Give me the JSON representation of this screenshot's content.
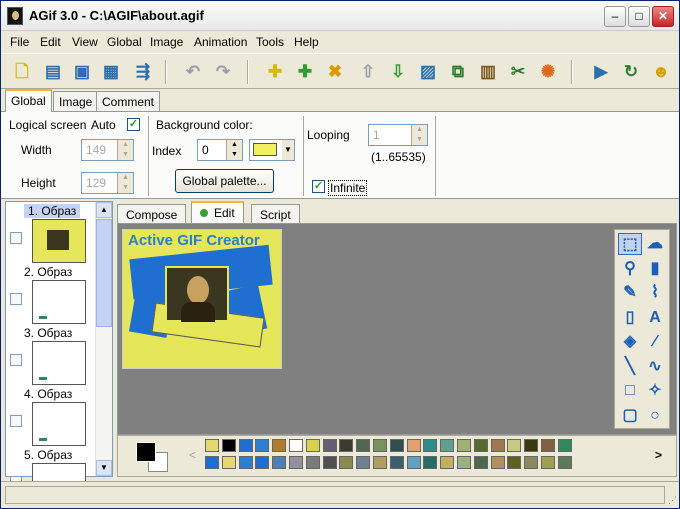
{
  "window": {
    "title": "AGif 3.0 - C:\\AGIF\\about.agif",
    "minimize_glyph": "–",
    "maximize_glyph": "□",
    "close_glyph": "✕"
  },
  "menu": [
    "File",
    "Edit",
    "View",
    "Global",
    "Image",
    "Animation",
    "Tools",
    "Help"
  ],
  "toolbar": {
    "buttons": [
      {
        "name": "new-icon",
        "glyph": "🗋",
        "color": "#d6b800"
      },
      {
        "name": "open-icon",
        "glyph": "▤",
        "color": "#2a6fb0"
      },
      {
        "name": "save-icon",
        "glyph": "▣",
        "color": "#2a6fb0"
      },
      {
        "name": "save-as-icon",
        "glyph": "▦",
        "color": "#2a6fb0"
      },
      {
        "name": "export-icon",
        "glyph": "⇶",
        "color": "#2a6fb0"
      },
      {
        "name": "undo-icon",
        "glyph": "↶",
        "color": "#9aa0a8"
      },
      {
        "name": "redo-icon",
        "glyph": "↷",
        "color": "#9aa0a8"
      },
      {
        "name": "new-frame-icon",
        "glyph": "✚",
        "color": "#d6b800"
      },
      {
        "name": "add-frame-icon",
        "glyph": "✚",
        "color": "#2e9e2e"
      },
      {
        "name": "delete-frame-icon",
        "glyph": "✖",
        "color": "#d89a00"
      },
      {
        "name": "move-up-icon",
        "glyph": "⇧",
        "color": "#9aa0a8"
      },
      {
        "name": "move-down-icon",
        "glyph": "⇩",
        "color": "#3a9e3a"
      },
      {
        "name": "image-props-icon",
        "glyph": "▨",
        "color": "#2a6fb0"
      },
      {
        "name": "duplicate-icon",
        "glyph": "⧉",
        "color": "#2e7d32"
      },
      {
        "name": "frames-icon",
        "glyph": "▥",
        "color": "#7a5a20"
      },
      {
        "name": "optimize-icon",
        "glyph": "✂",
        "color": "#2e7d32"
      },
      {
        "name": "effects-icon",
        "glyph": "✺",
        "color": "#e0661a"
      },
      {
        "name": "preview-icon",
        "glyph": "▶",
        "color": "#2a6fb0"
      },
      {
        "name": "play-icon",
        "glyph": "↻",
        "color": "#2e7d32"
      },
      {
        "name": "about-icon",
        "glyph": "☻",
        "color": "#d6a000"
      }
    ]
  },
  "top_tabs": [
    "Global",
    "Image",
    "Comment"
  ],
  "global": {
    "logical_screen_label": "Logical screen",
    "auto_label": "Auto",
    "auto_checked": "✓",
    "width_label": "Width",
    "width_value": "149",
    "height_label": "Height",
    "height_value": "129",
    "bg_color_label": "Background color:",
    "index_label": "Index",
    "index_value": "0",
    "bg_swatch": "#f0f060",
    "global_palette_button": "Global palette...",
    "looping_label": "Looping",
    "looping_value": "1",
    "looping_range": "(1..65535)",
    "infinite_label": "Infinite",
    "infinite_checked": "✓"
  },
  "frames": [
    {
      "label": "1. Образ",
      "selected": true
    },
    {
      "label": "2. Образ",
      "selected": false
    },
    {
      "label": "3. Образ",
      "selected": false
    },
    {
      "label": "4. Образ",
      "selected": false
    },
    {
      "label": "5. Образ",
      "selected": false
    }
  ],
  "scroll_up": "▲",
  "scroll_down": "▼",
  "sub_tabs": [
    "Compose",
    "Edit",
    "Script"
  ],
  "image": {
    "title": "Active GIF Creator"
  },
  "tools": [
    {
      "name": "select-rect-icon",
      "glyph": "⬚"
    },
    {
      "name": "lasso-icon",
      "glyph": "☁"
    },
    {
      "name": "paint-bucket-icon",
      "glyph": "⚲"
    },
    {
      "name": "eraser-icon",
      "glyph": "▮"
    },
    {
      "name": "pencil-icon",
      "glyph": "✎"
    },
    {
      "name": "brush-icon",
      "glyph": "⌇"
    },
    {
      "name": "marker-icon",
      "glyph": "▯"
    },
    {
      "name": "text-icon",
      "glyph": "A"
    },
    {
      "name": "fill-icon",
      "glyph": "◈"
    },
    {
      "name": "spray-icon",
      "glyph": "⁄"
    },
    {
      "name": "line-icon",
      "glyph": "╲"
    },
    {
      "name": "curve-icon",
      "glyph": "∿"
    },
    {
      "name": "rectangle-icon",
      "glyph": "□"
    },
    {
      "name": "star-icon",
      "glyph": "✧"
    },
    {
      "name": "rounded-rect-icon",
      "glyph": "▢"
    },
    {
      "name": "ellipse-icon",
      "glyph": "○"
    }
  ],
  "palette": {
    "prev_glyph": "<",
    "next_glyph": ">",
    "foreground": "#000000",
    "background": "#ffffff",
    "row1": [
      "#e6d870",
      "#000000",
      "#1e6fd0",
      "#2a7fd0",
      "#b07a30",
      "#ffffff",
      "#d8d050",
      "#606070",
      "#3a3a30",
      "#506850",
      "#7a9060",
      "#2f4f4f",
      "#e0a070",
      "#2e8b8b",
      "#5fa08f",
      "#a0b070",
      "#556b2f",
      "#a07850",
      "#c8c880",
      "#3a3a10",
      "#806040",
      "#2e8b57"
    ],
    "row2": [
      "#1e6fd0",
      "#e6d870",
      "#2a7fd0",
      "#1e6fd0",
      "#5080b0",
      "#9090a0",
      "#7a7a7a",
      "#505050",
      "#8a8a50",
      "#708090",
      "#b0a060",
      "#3a6070",
      "#60a0c0",
      "#2a6a6a",
      "#c0b060",
      "#9ab080",
      "#4a6a4a",
      "#b09060",
      "#606020",
      "#8a8a60",
      "#a0a050",
      "#5a7a5a"
    ]
  }
}
